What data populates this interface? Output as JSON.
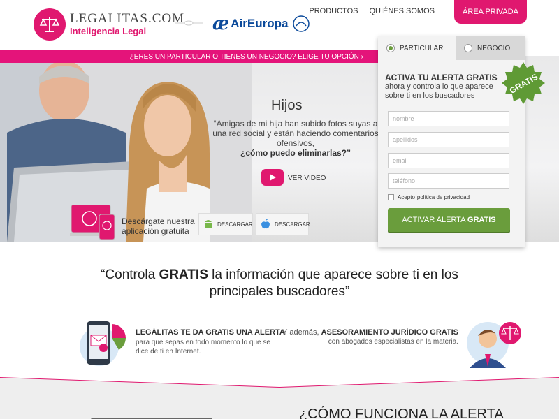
{
  "header": {
    "logo_title": "LEGALITAS.COM",
    "logo_subtitle": "Inteligencia Legal",
    "partner_name": "AirEuropa",
    "partner_glyph": "æ",
    "nav": [
      "PRODUCTOS",
      "QUIÉNES SOMOS"
    ],
    "private_area": "ÁREA PRIVADA"
  },
  "strip": {
    "text": "¿ERES UN PARTICULAR O TIENES UN NEGOCIO? ELIGE TU OPCIÓN  ›"
  },
  "hero": {
    "title": "Hijos",
    "quote": "“Amigas de mi hija han subido fotos suyas a una red social y están haciendo comentarios ofensivos,",
    "quote_bold": "¿cómo puedo eliminarlas?”",
    "video_label": "VER VIDEO",
    "app_text_1": "Descárgate nuestra",
    "app_text_2": "aplicación gratuita",
    "download_android": "DESCARGAR",
    "download_apple": "DESCARGAR"
  },
  "form": {
    "tab_particular": "PARTICULAR",
    "tab_negocio": "NEGOCIO",
    "title": "ACTIVA TU ALERTA GRATIS",
    "subtitle": "ahora y controla lo que aparece sobre ti en los buscadores",
    "badge": "GRATIS",
    "placeholders": {
      "name": "nombre",
      "surname": "apellidos",
      "email": "email",
      "phone": "teléfono"
    },
    "accept_text": "Acepto",
    "policy_text": "política de privacidad",
    "cta_prefix": "ACTIVAR ALERTA ",
    "cta_bold": "GRATIS"
  },
  "headline": {
    "pre": "“Controla ",
    "bold": "GRATIS",
    "post": " la información que aparece sobre ti en los principales buscadores”"
  },
  "features": {
    "f1_title": "LEGÁLITAS TE DA GRATIS UNA ALERTA",
    "f1_body": "para que sepas en todo momento lo que se dice de ti en Internet.",
    "f2_pre": "Y además, ",
    "f2_bold": "ASESORAMIENTO JURÍDICO GRATIS",
    "f2_body": "con abogados especialistas en la materia."
  },
  "bottom": {
    "title": "¿CÓMO FUNCIONA LA ALERTA"
  },
  "colors": {
    "brand": "#e0186f",
    "green": "#6a9d3c",
    "airline": "#0b4a9b"
  }
}
